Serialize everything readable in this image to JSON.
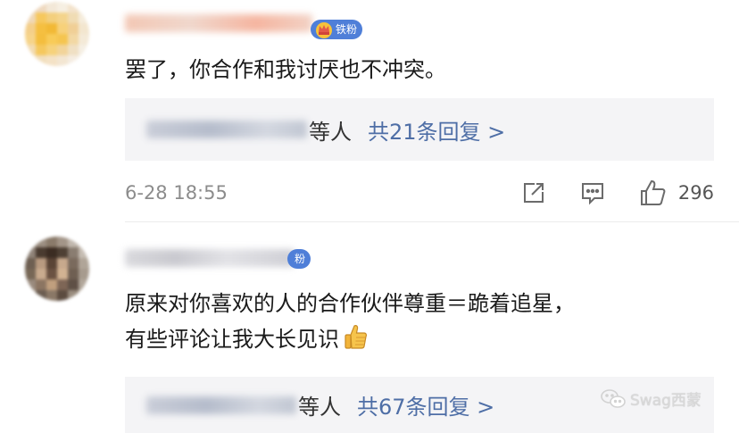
{
  "comments": [
    {
      "badge_label": "铁粉",
      "text": "罢了，你合作和我讨厌也不冲突。",
      "reply_suffix": "等人",
      "reply_link": "共21条回复 >",
      "timestamp": "6-28 18:55",
      "like_count": "296"
    },
    {
      "badge_label": "粉",
      "text_line1": "原来对你喜欢的人的合作伙伴尊重＝跪着追星，",
      "text_line2": "有些评论让我大长见识",
      "reply_suffix": "等人",
      "reply_link": "共67条回复 >"
    }
  ],
  "watermark": {
    "label": "Swag西蒙"
  },
  "colors": {
    "link": "#4e6ea6",
    "badge": "#4f7fd8",
    "reply_bg": "#f4f4f6",
    "meta_text": "#8c8c8c"
  },
  "icons": [
    "crown-icon",
    "share-icon",
    "comment-icon",
    "like-icon",
    "thumbs-up-emoji-icon",
    "wechat-icon"
  ]
}
